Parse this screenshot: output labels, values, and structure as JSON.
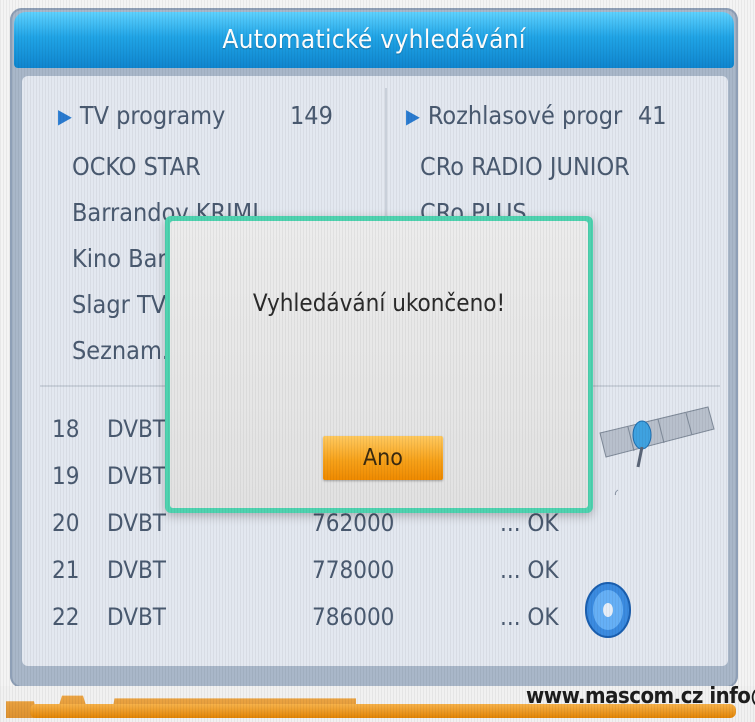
{
  "title": "Automatické vyhledávání",
  "tv": {
    "label": "TV programy",
    "count": "149",
    "channels": [
      "OCKO STAR",
      "Barrandov KRIMI",
      "Kino Barrandov",
      "Slagr TV",
      "Seznam.cz"
    ]
  },
  "radio": {
    "label": "Rozhlasové progr",
    "count": "41",
    "channels": [
      "CRo RADIO JUNIOR",
      "CRo PLUS"
    ]
  },
  "transponders": [
    {
      "num": "18",
      "type": "DVBT",
      "freq": "",
      "status": ""
    },
    {
      "num": "19",
      "type": "DVBT",
      "freq": "",
      "status": ""
    },
    {
      "num": "20",
      "type": "DVBT",
      "freq": "762000",
      "status": "... OK"
    },
    {
      "num": "21",
      "type": "DVBT",
      "freq": "778000",
      "status": "... OK"
    },
    {
      "num": "22",
      "type": "DVBT",
      "freq": "786000",
      "status": "... OK"
    }
  ],
  "dialog": {
    "message": "Vyhledávání ukončeno!",
    "button": "Ano"
  },
  "footer": {
    "url": "www.mascom.cz   info@m"
  },
  "colors": {
    "title_bar": "#20a4e6",
    "dialog_border": "#4fd3b0",
    "button": "#f7a21a",
    "text": "#4a5a70"
  },
  "icons": {
    "tv_arrow": "play-triangle-icon",
    "radio_arrow": "play-triangle-icon",
    "satellite": "satellite-icon",
    "disc": "disc-icon"
  }
}
